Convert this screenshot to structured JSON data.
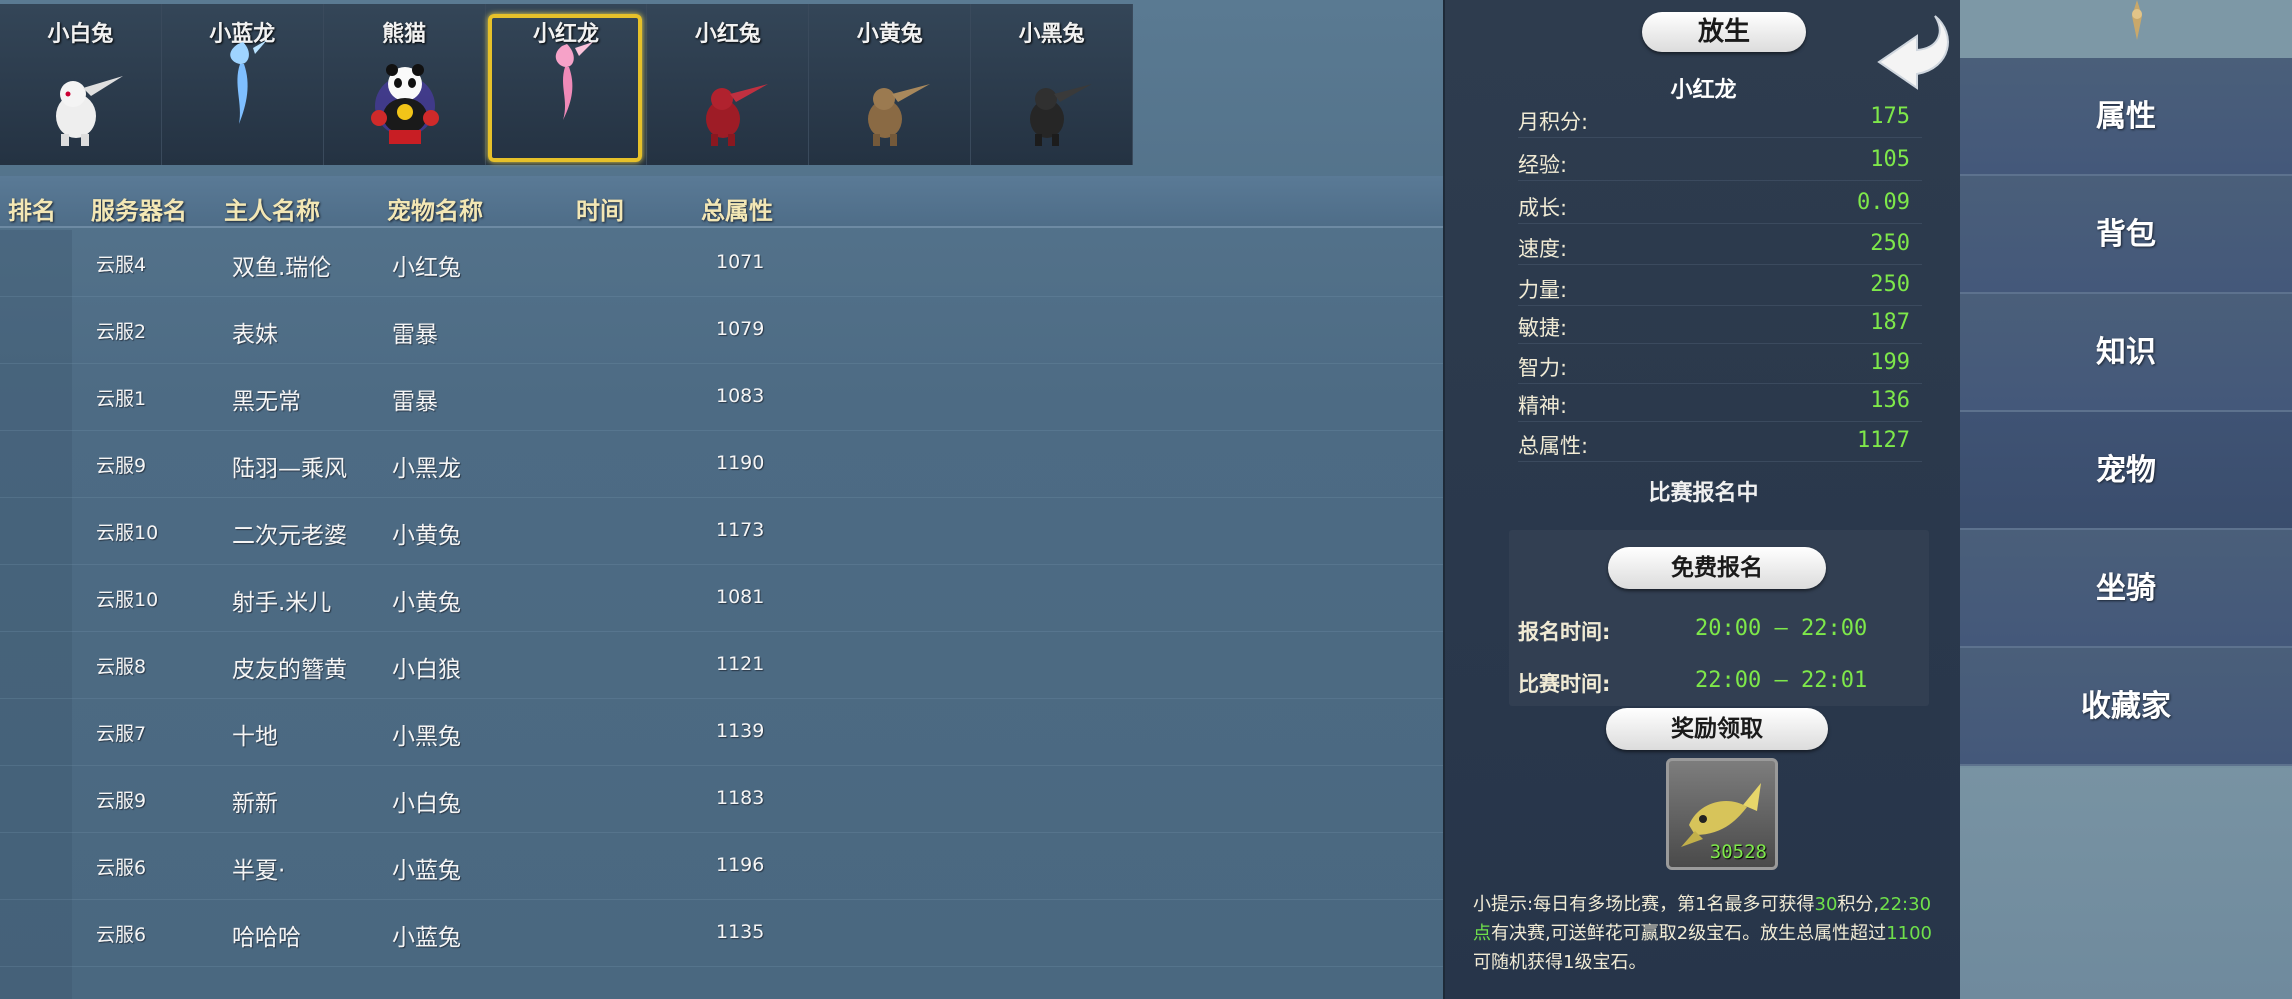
{
  "pets": [
    {
      "name": "小白兔",
      "icon": "white-rabbit-icon",
      "color": "#e8e8e8"
    },
    {
      "name": "小蓝龙",
      "icon": "blue-dragon-icon",
      "color": "#8fc8ff"
    },
    {
      "name": "熊猫",
      "icon": "panda-icon",
      "color": "#ffffff"
    },
    {
      "name": "小红龙",
      "icon": "pink-dragon-icon",
      "color": "#f08ab8"
    },
    {
      "name": "小红兔",
      "icon": "red-rabbit-icon",
      "color": "#a8202a"
    },
    {
      "name": "小黄兔",
      "icon": "yellow-rabbit-icon",
      "color": "#8a6a44"
    },
    {
      "name": "小黑兔",
      "icon": "black-rabbit-icon",
      "color": "#2a2a2a"
    }
  ],
  "table": {
    "headers": {
      "rank": "排名",
      "server": "服务器名",
      "owner": "主人名称",
      "pet": "宠物名称",
      "time": "时间",
      "total": "总属性"
    },
    "rows": [
      {
        "server": "云服4",
        "owner": "双鱼.瑞伦",
        "pet": "小红兔",
        "total": "1071"
      },
      {
        "server": "云服2",
        "owner": "表妹",
        "pet": "雷暴",
        "total": "1079"
      },
      {
        "server": "云服1",
        "owner": "黑无常",
        "pet": "雷暴",
        "total": "1083"
      },
      {
        "server": "云服9",
        "owner": "陆羽—乘风",
        "pet": "小黑龙",
        "total": "1190"
      },
      {
        "server": "云服10",
        "owner": "二次元老婆",
        "pet": "小黄兔",
        "total": "1173"
      },
      {
        "server": "云服10",
        "owner": "射手.米儿",
        "pet": "小黄兔",
        "total": "1081"
      },
      {
        "server": "云服8",
        "owner": "皮友的簪黄",
        "pet": "小白狼",
        "total": "1121"
      },
      {
        "server": "云服7",
        "owner": "十地",
        "pet": "小黑兔",
        "total": "1139"
      },
      {
        "server": "云服9",
        "owner": "新新",
        "pet": "小白兔",
        "total": "1183"
      },
      {
        "server": "云服6",
        "owner": "半夏·",
        "pet": "小蓝兔",
        "total": "1196"
      },
      {
        "server": "云服6",
        "owner": "哈哈哈",
        "pet": "小蓝兔",
        "total": "1135"
      }
    ]
  },
  "detail": {
    "release_label": "放生",
    "pet_name": "小红龙",
    "stats": [
      {
        "label": "月积分:",
        "value": "175"
      },
      {
        "label": "经验:",
        "value": "105"
      },
      {
        "label": "成长:",
        "value": "0.09"
      },
      {
        "label": "速度:",
        "value": "250"
      },
      {
        "label": "力量:",
        "value": "250"
      },
      {
        "label": "敏捷:",
        "value": "187"
      },
      {
        "label": "智力:",
        "value": "199"
      },
      {
        "label": "精神:",
        "value": "136"
      },
      {
        "label": "总属性:",
        "value": "1127"
      }
    ],
    "match_status": "比赛报名中",
    "free_signup_label": "免费报名",
    "signup_time_label": "报名时间:",
    "signup_time_value": "20:00 — 22:00",
    "match_time_label": "比赛时间:",
    "match_time_value": "22:00 — 22:01",
    "reward_label": "奖励领取",
    "reward_count": "30528",
    "tip_1": "小提示:每日有多场比赛，第1名最多可获得",
    "tip_hl1": "30",
    "tip_2": "积分,",
    "tip_hl2": "22:30点",
    "tip_3": "有决赛,可送鲜花可赢取2级宝石",
    "tip_4": "。放生总属性超过",
    "tip_hl3": "1100",
    "tip_5": "可随机获得1级宝石。"
  },
  "menu": {
    "items": [
      "属性",
      "背包",
      "知识",
      "宠物",
      "坐骑",
      "收藏家"
    ],
    "active": "宠物"
  },
  "colors": {
    "accent_green": "#7ee84a",
    "highlight_gold": "#e6c12a",
    "header_text": "#f3e7b5"
  }
}
